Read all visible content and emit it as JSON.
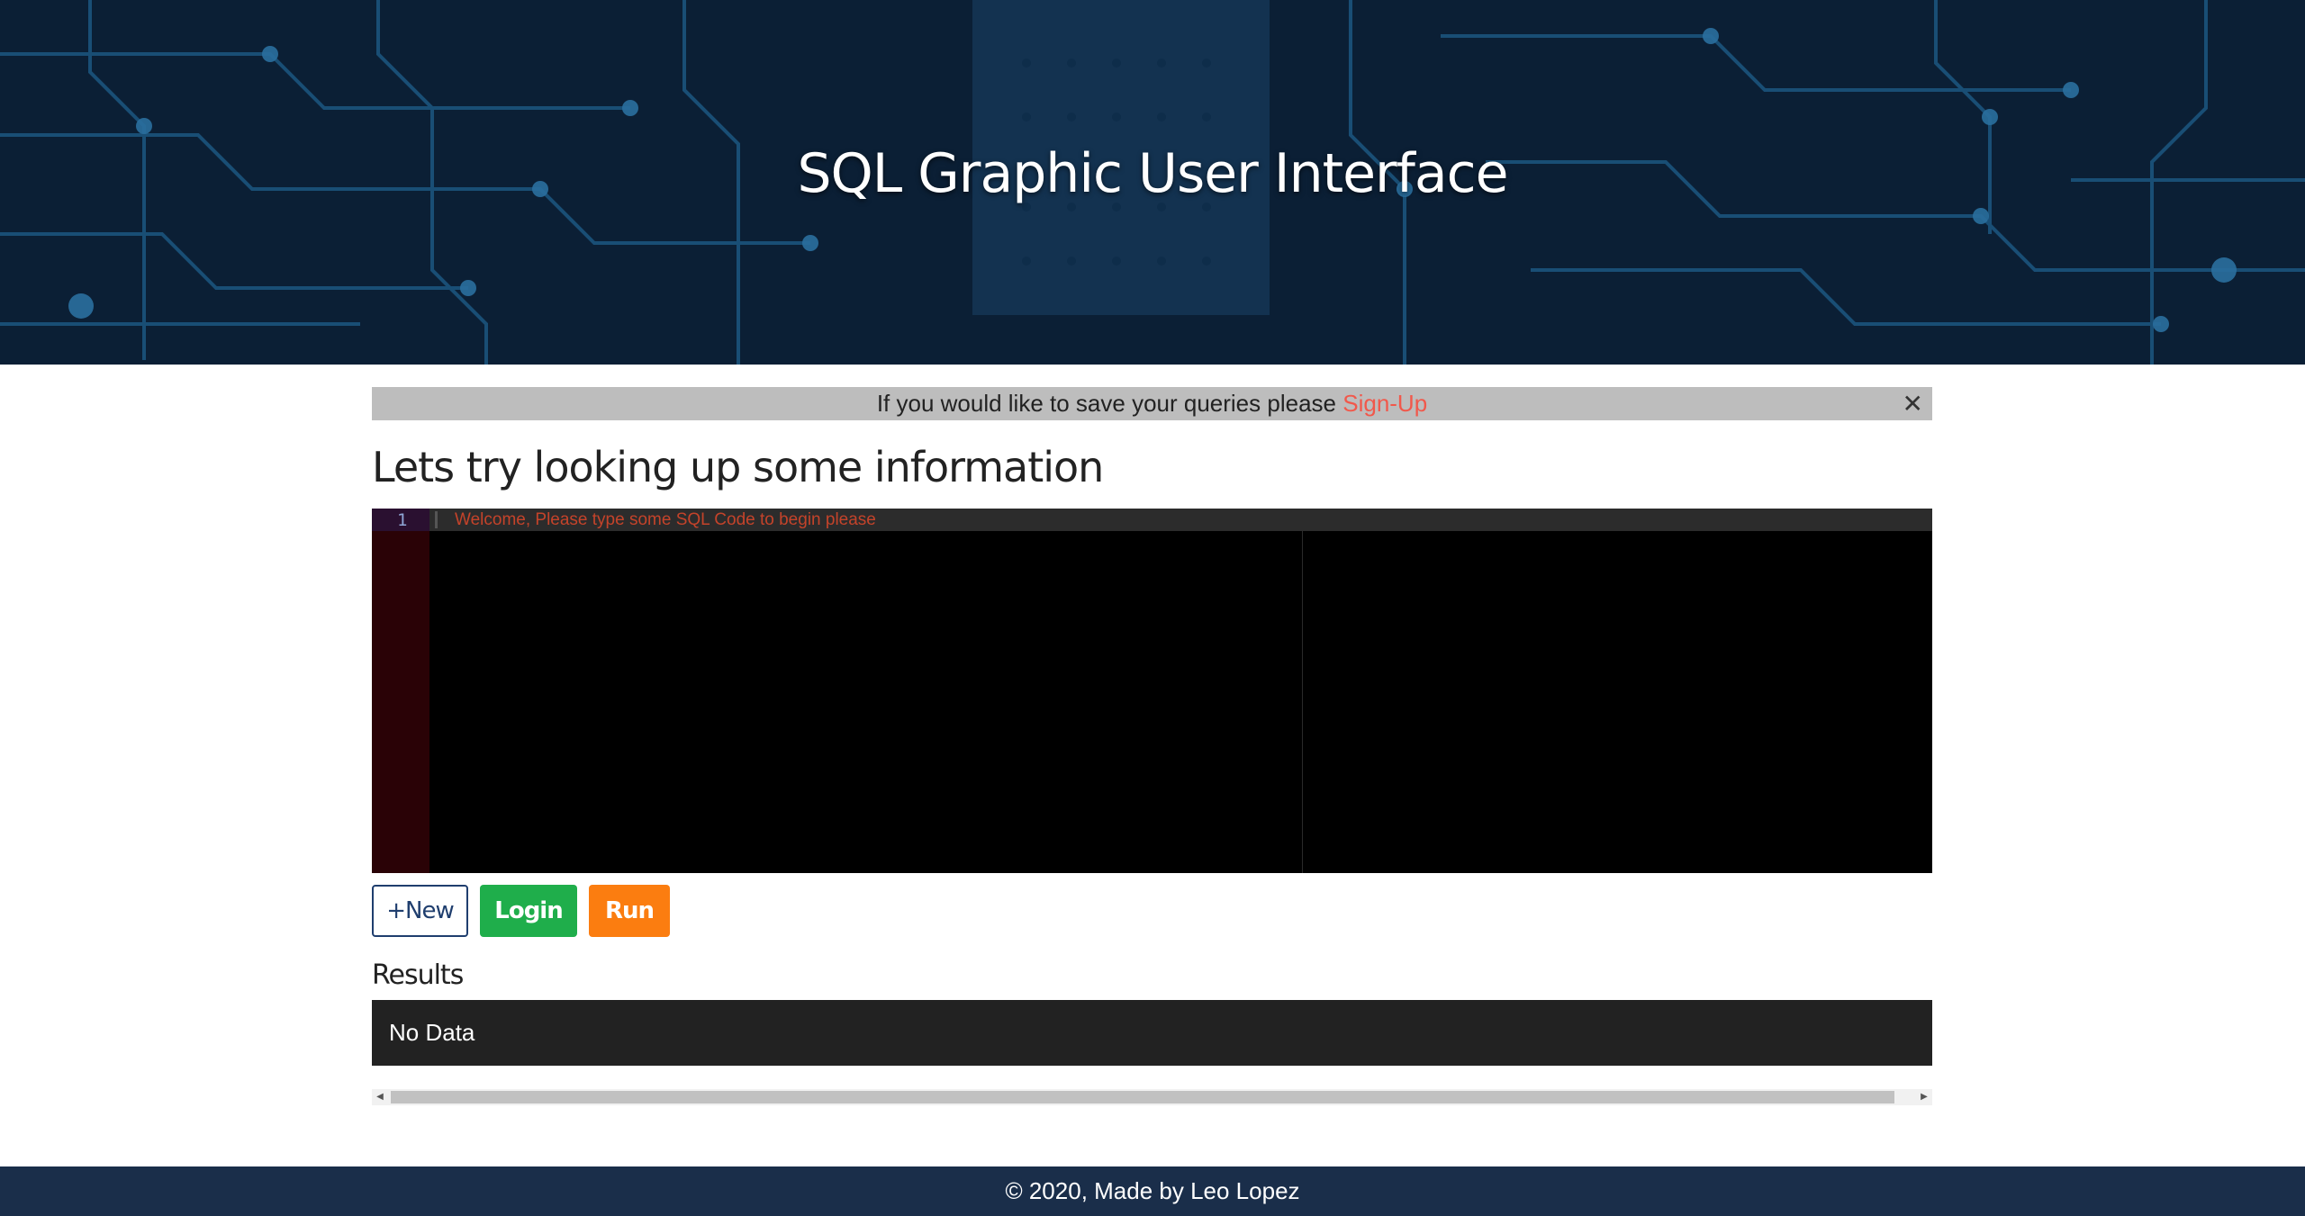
{
  "header": {
    "title": "SQL Graphic User Interface"
  },
  "alert": {
    "message": "If you would like to save your queries please",
    "signup_link": "Sign-Up",
    "close_glyph": "✕"
  },
  "main": {
    "title": "Lets try looking up some information"
  },
  "editor": {
    "line_number": "1",
    "placeholder": "Welcome, Please type some SQL Code to begin please"
  },
  "actions": {
    "new_label": "+New",
    "login_label": "Login",
    "run_label": "Run"
  },
  "results": {
    "label": "Results",
    "empty_text": "No Data"
  },
  "scrollbar": {
    "left_arrow": "◀",
    "right_arrow": "▶"
  },
  "footer": {
    "text": "© 2020, Made by Leo Lopez"
  },
  "colors": {
    "signup": "#f1584b",
    "login_button": "#1fae4b",
    "run_button": "#fb7d10",
    "new_button_border": "#1f3e6e",
    "footer_bg": "#1a2e4a",
    "results_bg": "#222222"
  }
}
